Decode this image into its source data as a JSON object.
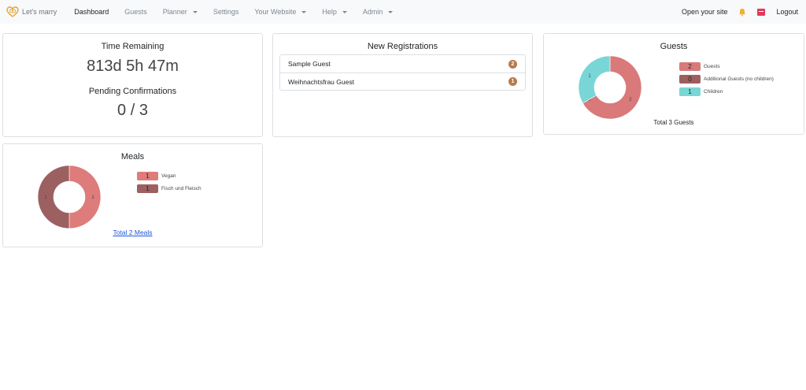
{
  "nav": {
    "brand": "Let's marry",
    "items": [
      {
        "label": "Dashboard"
      },
      {
        "label": "Guests"
      },
      {
        "label": "Planner"
      },
      {
        "label": "Settings"
      },
      {
        "label": "Your Website"
      },
      {
        "label": "Help"
      },
      {
        "label": "Admin"
      }
    ],
    "open_site": "Open your site",
    "logout": "Logout"
  },
  "time_card": {
    "title": "Time Remaining",
    "value": "813d 5h 47m",
    "pending_title": "Pending Confirmations",
    "pending_value": "0 / 3"
  },
  "registrations": {
    "title": "New Registrations",
    "items": [
      {
        "name": "Sample Guest",
        "count": "2"
      },
      {
        "name": "Weihnachtsfrau Guest",
        "count": "1"
      }
    ]
  },
  "guests_card": {
    "title": "Guests",
    "legend": [
      {
        "value": "2",
        "label": "Guests"
      },
      {
        "value": "0",
        "label": "Additional Guests (no children)"
      },
      {
        "value": "1",
        "label": "Children"
      }
    ],
    "slice_labels": [
      "2",
      "0",
      "1"
    ],
    "total": "Total 3 Guests"
  },
  "meals_card": {
    "title": "Meals",
    "legend": [
      {
        "value": "1",
        "label": "Vegan"
      },
      {
        "value": "1",
        "label": "Fisch und Fleisch"
      }
    ],
    "slice_labels": [
      "1",
      "1"
    ],
    "total": "Total 2 Meals"
  },
  "colors": {
    "guests": "#d9797a",
    "additional": "#9e5e5e",
    "children": "#79d6d6",
    "vegan": "#dd7c7b",
    "fisch": "#9d6060",
    "badge": "#b77a4f",
    "brand": "#e6a532"
  },
  "chart_data": [
    {
      "type": "pie",
      "categories": [
        "Guests",
        "Additional Guests (no children)",
        "Children"
      ],
      "values": [
        2,
        0,
        1
      ],
      "title": "Guests"
    },
    {
      "type": "pie",
      "categories": [
        "Vegan",
        "Fisch und Fleisch"
      ],
      "values": [
        1,
        1
      ],
      "title": "Meals"
    }
  ]
}
